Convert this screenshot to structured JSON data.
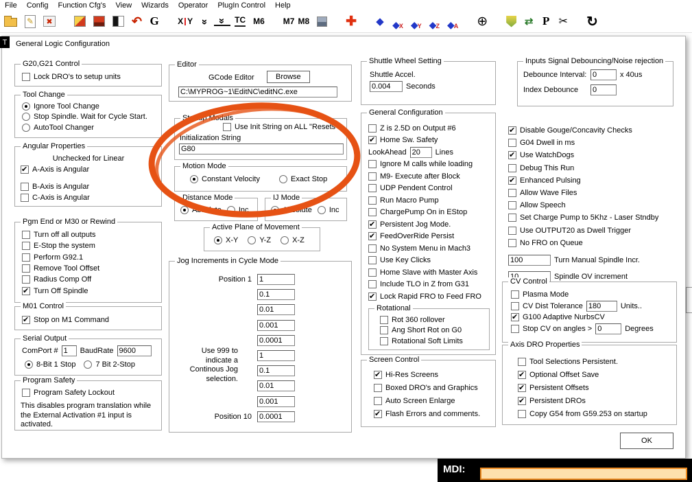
{
  "menu": {
    "items": [
      "File",
      "Config",
      "Function Cfg's",
      "View",
      "Wizards",
      "Operator",
      "PlugIn Control",
      "Help"
    ]
  },
  "toolbar": {
    "glyphs": {
      "edit": "✎",
      "close": "✖",
      "undo": "↶",
      "g": "G",
      "x": "X",
      "y": "Y",
      "chev": "»",
      "tc": "TC",
      "m6": "M6",
      "m7": "M7",
      "m8": "M8",
      "plus": "✚",
      "diamond": "◆",
      "sub_x": "X",
      "sub_y": "Y",
      "sub_z": "Z",
      "sub_a": "A",
      "crosshair": "⊕",
      "swap": "⇄",
      "p": "P",
      "scissors": "✂",
      "refresh": "↻"
    },
    "css_icons": {
      "open_file": "folder-shape",
      "estop": "yellow-red-block",
      "reset": "red-block",
      "display_mode": "black-white-block",
      "coolant": "gray-blue-block",
      "safety_shield": "shield-shape"
    }
  },
  "dialog": {
    "title": "General Logic Configuration",
    "corner_tag": "T",
    "ok_label": "OK"
  },
  "g20": {
    "title": "G20,G21 Control",
    "items": [
      {
        "t": "check",
        "label": "Lock DRO's to setup units",
        "on": false
      }
    ]
  },
  "tool_change": {
    "title": "Tool Change",
    "items": [
      {
        "t": "radio",
        "label": "Ignore Tool Change",
        "on": true
      },
      {
        "t": "radio",
        "label": "Stop Spindle. Wait for Cycle Start.",
        "on": false
      },
      {
        "t": "radio",
        "label": "AutoTool Changer",
        "on": false
      }
    ]
  },
  "angular": {
    "title": "Angular Properties",
    "items": [
      {
        "t": "text",
        "label": "Unchecked for Linear",
        "cls": "center"
      },
      {
        "t": "check",
        "label": "A-Axis is Angular",
        "on": true
      },
      {
        "t": "check",
        "label": "B-Axis is Angular",
        "on": false,
        "sp": 9
      },
      {
        "t": "check",
        "label": "C-Axis is Angular",
        "on": false
      }
    ]
  },
  "pgm_end": {
    "title": "Pgm End or M30 or Rewind",
    "items": [
      {
        "t": "check",
        "label": "Turn off all outputs",
        "on": false
      },
      {
        "t": "check",
        "label": "E-Stop the system",
        "on": false
      },
      {
        "t": "check",
        "label": "Perform G92.1",
        "on": false
      },
      {
        "t": "check",
        "label": "Remove Tool Offset",
        "on": false
      },
      {
        "t": "check",
        "label": "Radius Comp Off",
        "on": false
      },
      {
        "t": "check",
        "label": "Turn Off Spindle",
        "on": true
      }
    ]
  },
  "m01": {
    "title": "M01 Control",
    "items": [
      {
        "t": "check",
        "label": "Stop on M1 Command",
        "on": true
      }
    ]
  },
  "serial": {
    "title": "Serial Output",
    "comport_label": "ComPort #",
    "comport_value": "1",
    "baud_label": "BaudRate",
    "baud_value": "9600",
    "items": [
      {
        "t": "radio",
        "label": "8-Bit 1 Stop",
        "on": true
      },
      {
        "t": "radio",
        "label": "7 Bit 2-Stop",
        "on": false
      }
    ]
  },
  "safety": {
    "title": "Program Safety",
    "items": [
      {
        "t": "check",
        "label": "Program Safety Lockout",
        "on": false
      }
    ],
    "note": "This disables program translation while the External Activation #1 input is activated."
  },
  "editor": {
    "title": "Editor",
    "gcode_label": "GCode Editor",
    "browse_label": "Browse",
    "path": "C:\\MYPROG~1\\EditNC\\editNC.exe"
  },
  "startup": {
    "title": "Startup Modals",
    "items": [
      {
        "t": "check",
        "label": "Use Init String on ALL  \"Resets\"",
        "on": false
      }
    ],
    "init_label": "Initialization String",
    "init_value": "G80"
  },
  "motion": {
    "title": "Motion Mode",
    "items": [
      {
        "t": "radio",
        "label": "Constant Velocity",
        "on": true
      },
      {
        "t": "radio",
        "label": "Exact Stop",
        "on": false
      }
    ]
  },
  "distance": {
    "title": "Distance Mode",
    "items": [
      {
        "t": "radio",
        "label": "Absolute",
        "on": true
      },
      {
        "t": "radio",
        "label": "Inc",
        "on": false
      }
    ]
  },
  "ij": {
    "title": "IJ Mode",
    "items": [
      {
        "t": "radio",
        "label": "Absolute",
        "on": true
      },
      {
        "t": "radio",
        "label": "Inc",
        "on": false
      }
    ]
  },
  "plane": {
    "title": "Active Plane of Movement",
    "items": [
      {
        "t": "radio",
        "label": "X-Y",
        "on": true
      },
      {
        "t": "radio",
        "label": "Y-Z",
        "on": false
      },
      {
        "t": "radio",
        "label": "X-Z",
        "on": false
      }
    ]
  },
  "jog": {
    "title": "Jog Increments in Cycle Mode",
    "note": "Use 999 to\nindicate a\nContinous Jog\nselection.",
    "items": [
      {
        "t": "input",
        "pre": "Position 1",
        "value": "1",
        "w": 55
      },
      {
        "t": "input",
        "value": "0.1",
        "w": 55
      },
      {
        "t": "input",
        "value": "0.01",
        "w": 55
      },
      {
        "t": "input",
        "value": "0.001",
        "w": 55
      },
      {
        "t": "input",
        "value": "0.0001",
        "w": 55
      },
      {
        "t": "input",
        "value": "1",
        "w": 55
      },
      {
        "t": "input",
        "value": "0.1",
        "w": 55
      },
      {
        "t": "input",
        "value": "0.01",
        "w": 55
      },
      {
        "t": "input",
        "value": "0.001",
        "w": 55
      },
      {
        "t": "input",
        "pre": "Position 10",
        "value": "0.0001",
        "w": 55
      }
    ]
  },
  "shuttle": {
    "title": "Shuttle Wheel Setting",
    "items": [
      {
        "t": "text",
        "label": "Shuttle Accel."
      },
      {
        "t": "input",
        "value": "0.004",
        "w": 48,
        "suf": "Seconds"
      }
    ]
  },
  "general": {
    "title": "General Configuration",
    "items": [
      {
        "t": "check",
        "label": "Z is 2.5D on Output #6",
        "on": false
      },
      {
        "t": "check",
        "label": "Home Sw. Safety",
        "on": true
      },
      {
        "t": "input",
        "pre": "LookAhead",
        "value": "20",
        "w": 32,
        "suf": "Lines"
      },
      {
        "t": "check",
        "label": "Ignore M calls while loading",
        "on": false
      },
      {
        "t": "check",
        "label": "M9- Execute after Block",
        "on": false
      },
      {
        "t": "check",
        "label": "UDP Pendent Control",
        "on": false
      },
      {
        "t": "check",
        "label": "Run Macro Pump",
        "on": false
      },
      {
        "t": "check",
        "label": "ChargePump On in EStop",
        "on": false
      },
      {
        "t": "check",
        "label": "Persistent Jog Mode.",
        "on": true
      },
      {
        "t": "check",
        "label": "FeedOverRide Persist",
        "on": true
      },
      {
        "t": "check",
        "label": "No System Menu in Mach3",
        "on": false
      },
      {
        "t": "check",
        "label": "Use Key Clicks",
        "on": false
      },
      {
        "t": "check",
        "label": "Home Slave with Master Axis",
        "on": false
      },
      {
        "t": "check",
        "label": "Include TLO in Z from G31",
        "on": false
      },
      {
        "t": "check",
        "label": "Lock Rapid FRO to Feed FRO",
        "on": true
      }
    ],
    "rotational": {
      "title": "Rotational",
      "items": [
        {
          "t": "check",
          "label": "Rot 360 rollover",
          "on": false
        },
        {
          "t": "check",
          "label": "Ang Short Rot on G0",
          "on": false
        },
        {
          "t": "check",
          "label": "Rotational Soft Limits",
          "on": false
        }
      ]
    }
  },
  "screen": {
    "title": "Screen Control",
    "items": [
      {
        "t": "check",
        "label": "Hi-Res Screens",
        "on": true
      },
      {
        "t": "check",
        "label": "Boxed DRO's and Graphics",
        "on": false
      },
      {
        "t": "check",
        "label": "Auto Screen Enlarge",
        "on": false
      },
      {
        "t": "check",
        "label": "Flash Errors and comments.",
        "on": true
      }
    ]
  },
  "debounce": {
    "title": "Inputs Signal Debouncing/Noise rejection",
    "items": [
      {
        "t": "input",
        "pre": "Debounce Interval:",
        "value": "0",
        "w": 38,
        "suf": "x 40us"
      },
      {
        "t": "input",
        "pre": "Index Debounce",
        "value": "0",
        "w": 38
      }
    ]
  },
  "right_list": {
    "items": [
      {
        "t": "check",
        "label": "Disable Gouge/Concavity Checks",
        "on": true
      },
      {
        "t": "check",
        "label": "G04 Dwell in ms",
        "on": false
      },
      {
        "t": "check",
        "label": "Use WatchDogs",
        "on": true
      },
      {
        "t": "check",
        "label": "Debug This Run",
        "on": false
      },
      {
        "t": "check",
        "label": "Enhanced Pulsing",
        "on": true
      },
      {
        "t": "check",
        "label": "Allow Wave Files",
        "on": false
      },
      {
        "t": "check",
        "label": "Allow Speech",
        "on": false
      },
      {
        "t": "check",
        "label": "Set Charge Pump to 5Khz  - Laser Stndby",
        "on": false
      },
      {
        "t": "check",
        "label": "Use OUTPUT20 as Dwell Trigger",
        "on": false
      },
      {
        "t": "check",
        "label": "No FRO on Queue",
        "on": false
      },
      {
        "t": "input",
        "value": "100",
        "w": 62,
        "suf": "Turn Manual Spindle Incr.",
        "sp": 6
      },
      {
        "t": "input",
        "value": "10",
        "w": 62,
        "suf": "Spindle OV increment",
        "sp": 4
      }
    ]
  },
  "cv": {
    "title": "CV Control",
    "items": [
      {
        "t": "check",
        "label": "Plasma Mode",
        "on": false
      },
      {
        "t": "check",
        "label": "CV Dist Tolerance",
        "on": false,
        "input": {
          "value": "180",
          "w": 45
        },
        "suf": "Units.."
      },
      {
        "t": "check",
        "label": "G100 Adaptive NurbsCV",
        "on": true
      },
      {
        "t": "check",
        "label": "Stop CV on angles >",
        "on": false,
        "input": {
          "value": "0",
          "w": 38
        },
        "suf": "Degrees"
      }
    ]
  },
  "axis_dro": {
    "title": "Axis DRO Properties",
    "items": [
      {
        "t": "check",
        "label": "Tool Selections Persistent.",
        "on": false
      },
      {
        "t": "check",
        "label": "Optional Offset Save",
        "on": true
      },
      {
        "t": "check",
        "label": "Persistent Offsets",
        "on": true
      },
      {
        "t": "check",
        "label": "Persistent DROs",
        "on": true
      },
      {
        "t": "check",
        "label": "Copy G54 from G59.253 on startup",
        "on": false
      }
    ]
  },
  "annotation": {
    "color": "#e65214"
  },
  "mdi": {
    "label": "MDI:",
    "value": ""
  }
}
